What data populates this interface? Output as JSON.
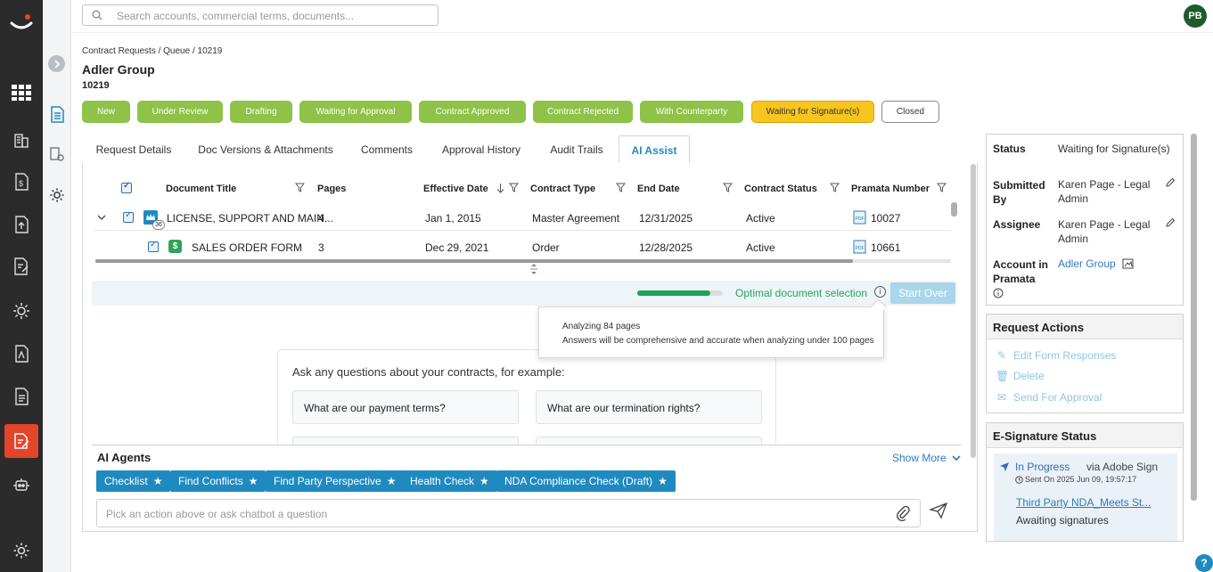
{
  "search": {
    "placeholder": "Search accounts, commercial terms, documents..."
  },
  "user": {
    "initials": "PB"
  },
  "breadcrumb": "Contract Requests / Queue / 10219",
  "page": {
    "title": "Adler Group",
    "id": "10219"
  },
  "status_steps": [
    {
      "label": "New",
      "state": "done"
    },
    {
      "label": "Under Review",
      "state": "done"
    },
    {
      "label": "Drafting",
      "state": "done"
    },
    {
      "label": "Waiting for Approval",
      "state": "done"
    },
    {
      "label": "Contract Approved",
      "state": "done"
    },
    {
      "label": "Contract Rejected",
      "state": "done"
    },
    {
      "label": "With Counterparty",
      "state": "done"
    },
    {
      "label": "Waiting for Signature(s)",
      "state": "current"
    },
    {
      "label": "Closed",
      "state": "pending"
    }
  ],
  "tabs": [
    {
      "label": "Request Details"
    },
    {
      "label": "Doc Versions & Attachments"
    },
    {
      "label": "Comments"
    },
    {
      "label": "Approval History"
    },
    {
      "label": "Audit Trails"
    },
    {
      "label": "AI Assist",
      "active": true
    }
  ],
  "grid": {
    "columns": [
      "Document Title",
      "Pages",
      "Effective Date",
      "Contract Type",
      "End Date",
      "Contract Status",
      "Pramata Number"
    ],
    "rows": [
      {
        "title": "LICENSE, SUPPORT AND MAIN...",
        "pages": "4",
        "effective": "Jan 1, 2015",
        "type": "Master Agreement",
        "end": "12/31/2025",
        "status": "Active",
        "number": "10027",
        "badge": "36"
      },
      {
        "title": "SALES ORDER FORM",
        "pages": "3",
        "effective": "Dec 29, 2021",
        "type": "Order",
        "end": "12/28/2025",
        "status": "Active",
        "number": "10661"
      }
    ]
  },
  "selection": {
    "progress_fraction": 0.85,
    "label": "Optimal document selection",
    "start_over": "Start Over"
  },
  "tooltip": {
    "line1": "Analyzing 84 pages",
    "line2": "Answers will be comprehensive and accurate when analyzing under 100 pages"
  },
  "ask": {
    "prompt": "Ask any questions about your contracts, for example:",
    "suggestions": [
      "What are our payment terms?",
      "What are our termination rights?"
    ]
  },
  "agents": {
    "title": "AI Agents",
    "show_more": "Show More",
    "chips": [
      "Checklist",
      "Find Conflicts",
      "Find Party Perspective",
      "Health Check",
      "NDA Compliance Check (Draft)"
    ],
    "input_placeholder": "Pick an action above or ask chatbot a question"
  },
  "sidebar": {
    "status_label": "Status",
    "status_value": "Waiting for Signature(s)",
    "submitted_label": "Submitted By",
    "submitted_value": "Karen Page - Legal Admin",
    "assignee_label": "Assignee",
    "assignee_value": "Karen Page - Legal Admin",
    "account_label": "Account in Pramata",
    "account_value": "Adler Group",
    "request_actions_title": "Request Actions",
    "actions": [
      "Edit Form Responses",
      "Delete",
      "Send For Approval"
    ],
    "esig_title": "E-Signature Status",
    "esig_status": "In Progress",
    "esig_via": "via Adobe Sign",
    "esig_sent": "Sent On 2025 Jun 09, 19:57:17",
    "esig_doc": "Third Party NDA_Meets St...",
    "esig_waiting": "Awaiting signatures"
  },
  "colors": {
    "accent": "#1f8ac0",
    "done": "#8ec248",
    "current": "#f7c51e",
    "brand": "#e3452a"
  }
}
